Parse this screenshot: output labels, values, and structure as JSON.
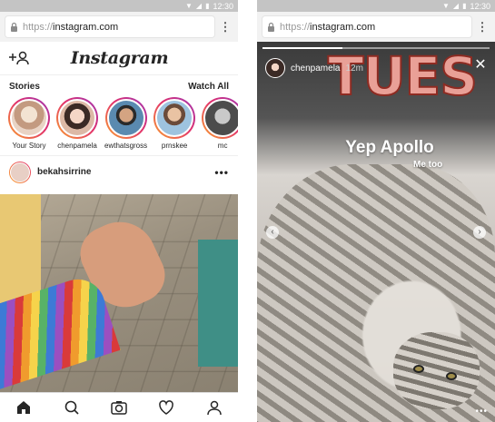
{
  "status_bar": {
    "time": "12:30"
  },
  "browser": {
    "url_protocol": "https://",
    "url_host": "instagram.com"
  },
  "feed": {
    "logo": "Instagram",
    "stories_title": "Stories",
    "watch_all": "Watch All",
    "stories": [
      {
        "label": "Your Story"
      },
      {
        "label": "chenpamela"
      },
      {
        "label": "ewthatsgross"
      },
      {
        "label": "prnskee"
      },
      {
        "label": "mc"
      }
    ],
    "post": {
      "username": "bekahsirrine"
    }
  },
  "story": {
    "username": "chenpamela",
    "time": "12m",
    "progress": 0.35,
    "big_text": "TUES",
    "caption": "Yep Apollo",
    "sub_caption": "Me too"
  },
  "colors": {
    "accent_gradient_start": "#f9a12e",
    "accent_gradient_mid": "#e1306c",
    "accent_gradient_end": "#9b36b7",
    "tues_fill": "#e9a097",
    "tues_stroke": "#8e2b22"
  },
  "icons": {
    "nav": [
      "home-icon",
      "search-icon",
      "camera-icon",
      "heart-icon",
      "profile-icon"
    ]
  }
}
